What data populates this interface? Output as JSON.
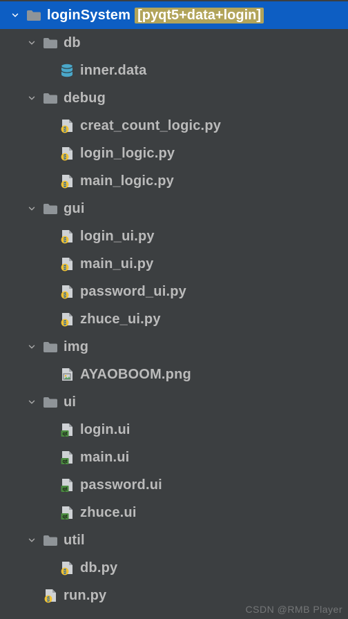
{
  "colors": {
    "bg": "#3c3f41",
    "selection": "#0d5ec3",
    "text": "#bbbbbb",
    "rootText": "#ffffff",
    "extraText": "#b2a45a",
    "folderFill": "#8f9498",
    "arrowStroke": "#a9a9a9",
    "dbFill": "#4aa7c9",
    "pyPage": "#cfd2d5",
    "pyFold": "#9ea2a6",
    "pyBadge": "#f1c232",
    "pySnake": "#2d6aa3",
    "qtBadgeBg": "#4a8a3f",
    "qtBadgeText": "#1a1a1a",
    "imgDot1": "#e8b92e",
    "imgDot2": "#5aa865"
  },
  "indentUnit": 24,
  "baseIndent": 12,
  "tree": [
    {
      "depth": 0,
      "expanded": true,
      "selected": true,
      "icon": "folder",
      "label": "loginSystem",
      "extra": "[pyqt5+data+login]",
      "root": true,
      "name": "project-root"
    },
    {
      "depth": 1,
      "expanded": true,
      "icon": "folder",
      "label": "db",
      "name": "folder-db"
    },
    {
      "depth": 2,
      "icon": "database",
      "label": "inner.data",
      "name": "file-inner-data"
    },
    {
      "depth": 1,
      "expanded": true,
      "icon": "folder",
      "label": "debug",
      "name": "folder-debug"
    },
    {
      "depth": 2,
      "icon": "python",
      "label": "creat_count_logic.py",
      "name": "file-creat-count-logic"
    },
    {
      "depth": 2,
      "icon": "python",
      "label": "login_logic.py",
      "name": "file-login-logic"
    },
    {
      "depth": 2,
      "icon": "python",
      "label": "main_logic.py",
      "name": "file-main-logic"
    },
    {
      "depth": 1,
      "expanded": true,
      "icon": "folder",
      "label": "gui",
      "name": "folder-gui"
    },
    {
      "depth": 2,
      "icon": "python",
      "label": "login_ui.py",
      "name": "file-login-ui-py"
    },
    {
      "depth": 2,
      "icon": "python",
      "label": "main_ui.py",
      "name": "file-main-ui-py"
    },
    {
      "depth": 2,
      "icon": "python",
      "label": "password_ui.py",
      "name": "file-password-ui-py"
    },
    {
      "depth": 2,
      "icon": "python",
      "label": "zhuce_ui.py",
      "name": "file-zhuce-ui-py"
    },
    {
      "depth": 1,
      "expanded": true,
      "icon": "folder",
      "label": "img",
      "name": "folder-img"
    },
    {
      "depth": 2,
      "icon": "image",
      "label": "AYAOBOOM.png",
      "name": "file-ayaoboom-png"
    },
    {
      "depth": 1,
      "expanded": true,
      "icon": "folder",
      "label": "ui",
      "name": "folder-ui"
    },
    {
      "depth": 2,
      "icon": "qt-ui",
      "label": "login.ui",
      "name": "file-login-ui"
    },
    {
      "depth": 2,
      "icon": "qt-ui",
      "label": "main.ui",
      "name": "file-main-ui"
    },
    {
      "depth": 2,
      "icon": "qt-ui",
      "label": "password.ui",
      "name": "file-password-ui"
    },
    {
      "depth": 2,
      "icon": "qt-ui",
      "label": "zhuce.ui",
      "name": "file-zhuce-ui"
    },
    {
      "depth": 1,
      "expanded": true,
      "icon": "folder",
      "label": "util",
      "name": "folder-util"
    },
    {
      "depth": 2,
      "icon": "python",
      "label": "db.py",
      "name": "file-db-py"
    },
    {
      "depth": 1,
      "icon": "python",
      "label": "run.py",
      "name": "file-run-py"
    }
  ],
  "watermark": "CSDN @RMB Player"
}
